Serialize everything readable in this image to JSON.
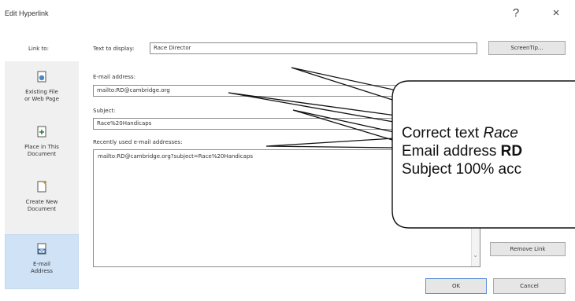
{
  "dialog": {
    "title": "Edit Hyperlink",
    "help_glyph": "?",
    "close_glyph": "×"
  },
  "link_to": {
    "label": "Link to:",
    "items": [
      {
        "label": "Existing File\nor Web Page",
        "icon": "file-globe-icon"
      },
      {
        "label": "Place in This\nDocument",
        "icon": "place-in-document-icon"
      },
      {
        "label": "Create New\nDocument",
        "icon": "new-document-icon"
      },
      {
        "label": "E-mail\nAddress",
        "icon": "email-icon",
        "selected": true
      }
    ]
  },
  "text_to_display": {
    "label": "Text to display:",
    "value": "Race Director"
  },
  "screentip_button": "ScreenTip...",
  "email_address": {
    "label": "E-mail address:",
    "value": "mailto:RD@cambridge.org"
  },
  "subject": {
    "label": "Subject:",
    "value": "Race%20Handicaps"
  },
  "recent": {
    "label": "Recently used e-mail addresses:",
    "items": [
      "mailto:RD@cambridge.org?subject=Race%20Handicaps"
    ]
  },
  "remove_link_button": "Remove Link",
  "ok_button": "OK",
  "cancel_button": "Cancel",
  "callout": {
    "line1_prefix": "Correct text ",
    "line1_italic": "Race",
    "line2_prefix": "Email address ",
    "line2_bold": "RD",
    "line3": "Subject 100% acc"
  },
  "colors": {
    "selected_bg": "#cfe2f6",
    "panel_bg": "#f0f0f0",
    "border": "#8a8a8a"
  }
}
